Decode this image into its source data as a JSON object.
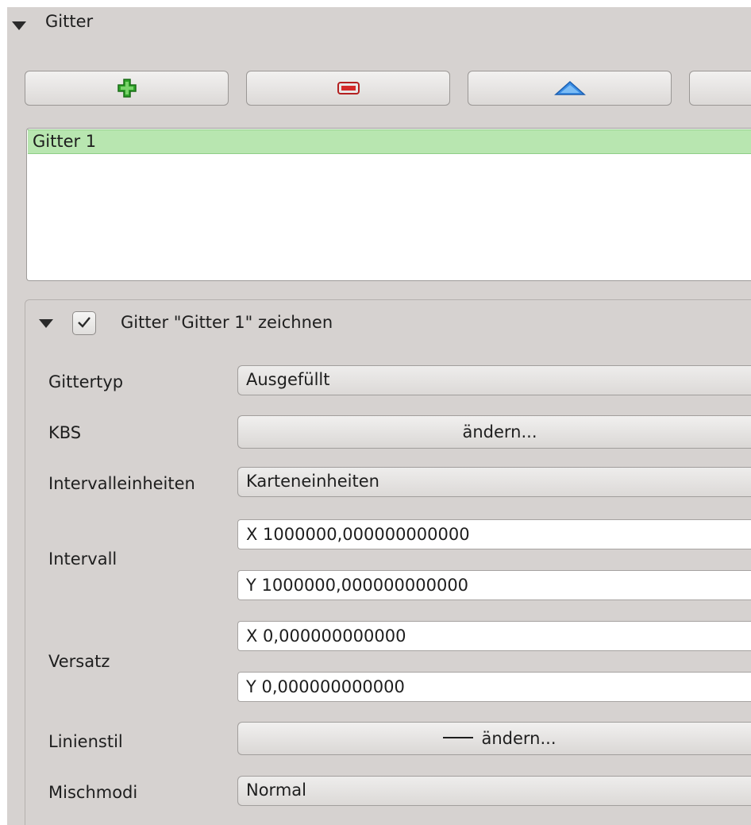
{
  "section": {
    "title": "Gitter"
  },
  "toolbar": {
    "add_icon": "plus-green-icon",
    "remove_icon": "minus-red-icon",
    "up_icon": "arrow-up-blue-icon"
  },
  "grid_list": {
    "items": [
      "Gitter 1"
    ]
  },
  "settings": {
    "title": "Gitter \"Gitter 1\" zeichnen",
    "checked": true,
    "grid_type": {
      "label": "Gittertyp",
      "value": "Ausgefüllt"
    },
    "crs": {
      "label": "KBS",
      "button": "ändern..."
    },
    "interval_units": {
      "label": "Intervalleinheiten",
      "value": "Karteneinheiten"
    },
    "interval": {
      "label": "Intervall",
      "x": "X 1000000,000000000000",
      "y": "Y 1000000,000000000000"
    },
    "offset": {
      "label": "Versatz",
      "x": "X 0,000000000000",
      "y": "Y 0,000000000000"
    },
    "line_style": {
      "label": "Linienstil",
      "button": "ändern..."
    },
    "blend_mode": {
      "label": "Mischmodi",
      "value": "Normal"
    }
  },
  "colors": {
    "selection": "#b8e6b0",
    "add": "#2fa42a",
    "remove": "#d42a2a",
    "up": "#3a8ee6"
  }
}
